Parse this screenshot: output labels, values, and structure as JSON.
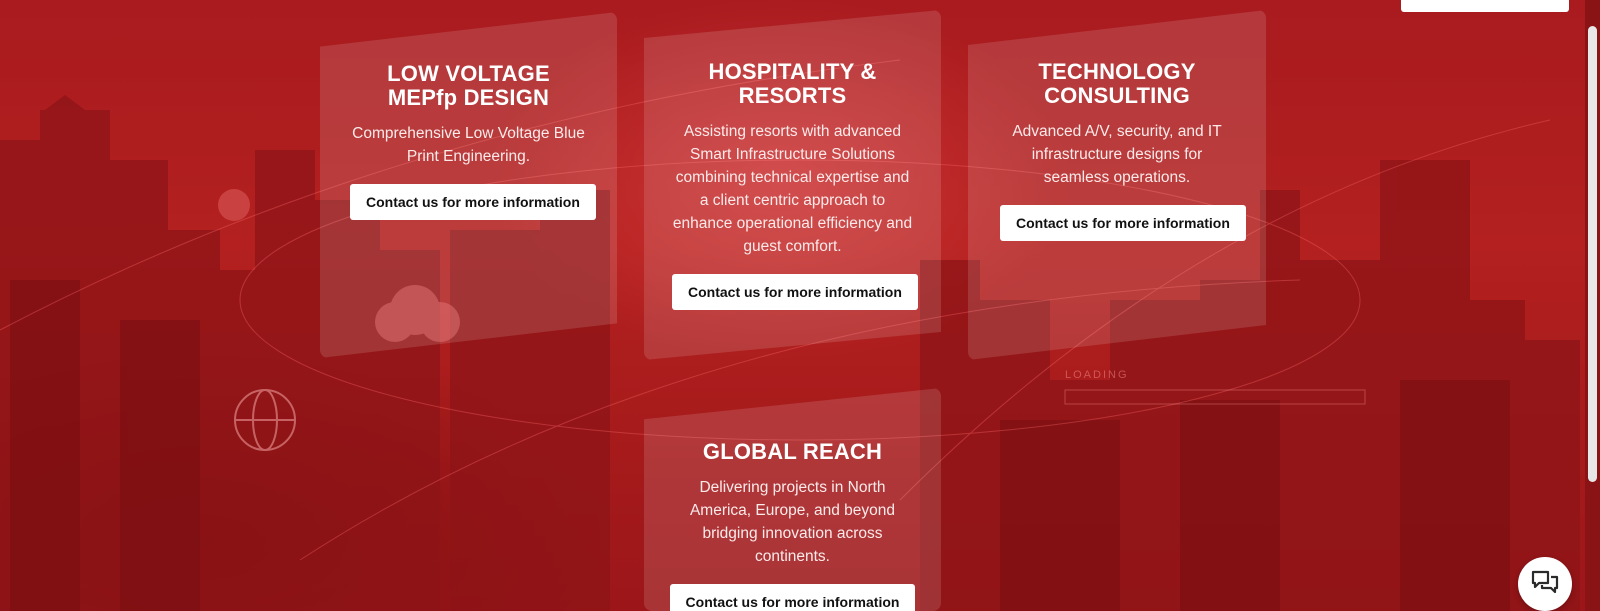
{
  "cards": [
    {
      "title": "LOW VOLTAGE MEPfp DESIGN",
      "description": "Comprehensive Low Voltage Blue Print Engineering.",
      "button": "Contact us for more information"
    },
    {
      "title": "HOSPITALITY & RESORTS",
      "description": "Assisting resorts with advanced Smart Infrastructure Solutions combining technical expertise and a client centric approach to enhance operational efficiency and guest comfort.",
      "button": "Contact us for more information"
    },
    {
      "title": "TECHNOLOGY CONSULTING",
      "description": "Advanced A/V, security, and IT infrastructure designs for seamless operations.",
      "button": "Contact us for more information"
    },
    {
      "title": "GLOBAL REACH",
      "description": "Delivering projects in North America, Europe, and beyond bridging innovation across continents.",
      "button": "Contact us for more information"
    }
  ],
  "background": {
    "overlay_text": "LOADING"
  },
  "icons": {
    "chat": "chat-bubbles-icon"
  },
  "colors": {
    "background": "#b01a1e",
    "card_panel": "rgba(255,255,255,0.13)",
    "button_bg": "#ffffff",
    "button_text": "#111111"
  }
}
